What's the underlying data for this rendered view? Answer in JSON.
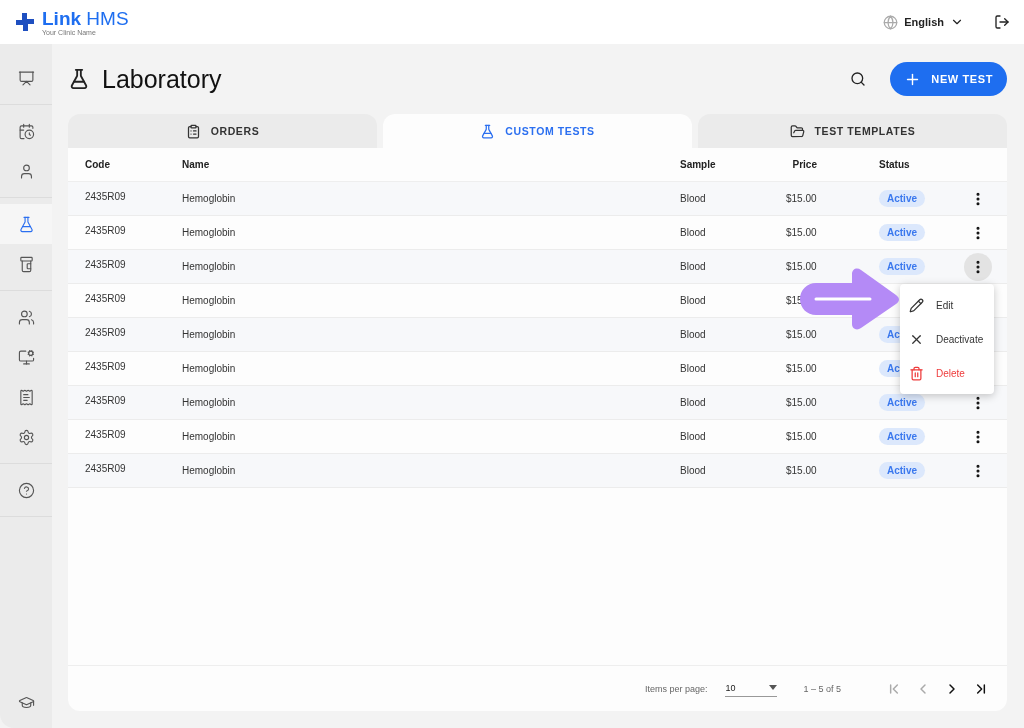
{
  "brand": {
    "name": "**Link** HMS",
    "tagline": "Your Clinic Name"
  },
  "topbar": {
    "language": "English"
  },
  "sidebar": {
    "groups": [
      [
        {
          "kind": "dashboard",
          "selected": false
        }
      ],
      [
        {
          "kind": "calendar",
          "selected": false
        },
        {
          "kind": "patient",
          "selected": false
        }
      ],
      [
        {
          "kind": "lab",
          "selected": true
        },
        {
          "kind": "pharmacy",
          "selected": false
        }
      ],
      [
        {
          "kind": "staff",
          "selected": false
        },
        {
          "kind": "monitor",
          "selected": false
        },
        {
          "kind": "billing",
          "selected": false
        },
        {
          "kind": "settings",
          "selected": false
        }
      ],
      [
        {
          "kind": "help",
          "selected": false
        }
      ]
    ],
    "bottom": {
      "kind": "training",
      "selected": false
    }
  },
  "page": {
    "title": "Laboratory",
    "new_button": "NEW TEST"
  },
  "tabs": [
    {
      "kind": "orders",
      "label": "ORDERS",
      "selected": false
    },
    {
      "kind": "lab",
      "label": "CUSTOM TESTS",
      "selected": true
    },
    {
      "kind": "templates",
      "label": "TEST TEMPLATES",
      "selected": false
    }
  ],
  "table": {
    "columns": [
      "Code",
      "Name",
      "Sample",
      "Price",
      "Status"
    ],
    "rows": [
      {
        "code": "2435R09",
        "name": "Hemoglobin",
        "sample": "Blood",
        "price": "$15.00",
        "status": "Active",
        "menu_open": false
      },
      {
        "code": "2435R09",
        "name": "Hemoglobin",
        "sample": "Blood",
        "price": "$15.00",
        "status": "Active",
        "menu_open": false
      },
      {
        "code": "2435R09",
        "name": "Hemoglobin",
        "sample": "Blood",
        "price": "$15.00",
        "status": "Active",
        "menu_open": true
      },
      {
        "code": "2435R09",
        "name": "Hemoglobin",
        "sample": "Blood",
        "price": "$15",
        "menu_open": false,
        "more_hidden": true
      },
      {
        "code": "2435R09",
        "name": "Hemoglobin",
        "sample": "Blood",
        "price": "$15.00",
        "status": "Ac",
        "menu_open": false,
        "more_hidden": true
      },
      {
        "code": "2435R09",
        "name": "Hemoglobin",
        "sample": "Blood",
        "price": "$15.00",
        "status": "Ac",
        "menu_open": false,
        "more_hidden": true
      },
      {
        "code": "2435R09",
        "name": "Hemoglobin",
        "sample": "Blood",
        "price": "$15.00",
        "status": "Active",
        "menu_open": false
      },
      {
        "code": "2435R09",
        "name": "Hemoglobin",
        "sample": "Blood",
        "price": "$15.00",
        "status": "Active",
        "menu_open": false
      },
      {
        "code": "2435R09",
        "name": "Hemoglobin",
        "sample": "Blood",
        "price": "$15.00",
        "status": "Active",
        "menu_open": false
      }
    ]
  },
  "row_menu": {
    "items": [
      {
        "kind": "edit",
        "label": "Edit"
      },
      {
        "kind": "deactivate",
        "label": "Deactivate"
      },
      {
        "kind": "delete",
        "label": "Delete"
      }
    ]
  },
  "pagination": {
    "label": "Items per page:",
    "page_size": "10",
    "range": "1 – 5 of 5",
    "buttons": [
      {
        "kind": "first",
        "disabled": true
      },
      {
        "kind": "prev",
        "disabled": true
      },
      {
        "kind": "next",
        "disabled": false
      },
      {
        "kind": "last",
        "disabled": false
      }
    ]
  }
}
